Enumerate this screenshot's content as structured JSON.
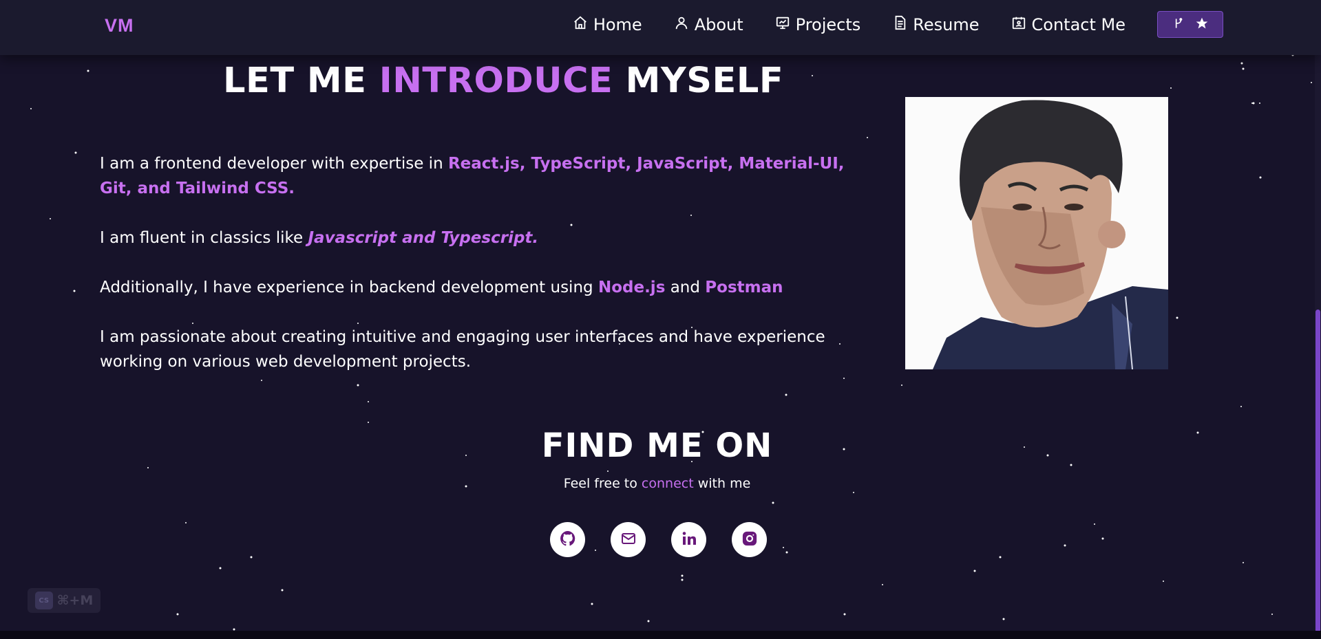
{
  "colors": {
    "accent": "#c770f0",
    "background": "#17132a",
    "navbar_bg": "#1b1a2e",
    "star_button_bg": "#4b2d7f",
    "social_icon": "#68187a"
  },
  "nav": {
    "logo": "VM",
    "items": [
      {
        "label": "Home",
        "icon": "home-icon"
      },
      {
        "label": "About",
        "icon": "user-icon"
      },
      {
        "label": "Projects",
        "icon": "presentation-icon"
      },
      {
        "label": "Resume",
        "icon": "document-icon"
      },
      {
        "label": "Contact Me",
        "icon": "calendar-contact-icon"
      }
    ],
    "star_button_icons": [
      "git-fork-icon",
      "star-icon"
    ]
  },
  "intro": {
    "title_part1": "LET ME",
    "title_highlight": "INTRODUCE",
    "title_part2": "MYSELF",
    "p1_text": "I am a frontend developer with expertise in",
    "p1_highlight": "React.js, TypeScript, JavaScript, Material-UI, Git, and Tailwind CSS.",
    "p2_text": "I am fluent in classics like",
    "p2_highlight": "Javascript and Typescript.",
    "p3_text": "Additionally, I have experience in backend development using",
    "p3_highlight1": "Node.js",
    "p3_and": "and",
    "p3_highlight2": "Postman",
    "p4_text": "I am passionate about creating intuitive and engaging user interfaces and have experience working on various web development projects."
  },
  "find": {
    "title": "FIND ME ON",
    "sub_before": "Feel free to",
    "sub_highlight": "connect",
    "sub_after": "with me",
    "socials": [
      "github-icon",
      "mail-icon",
      "linkedin-icon",
      "instagram-icon"
    ]
  },
  "shortcut": {
    "badge": "CS",
    "keys": "⌘+M"
  }
}
